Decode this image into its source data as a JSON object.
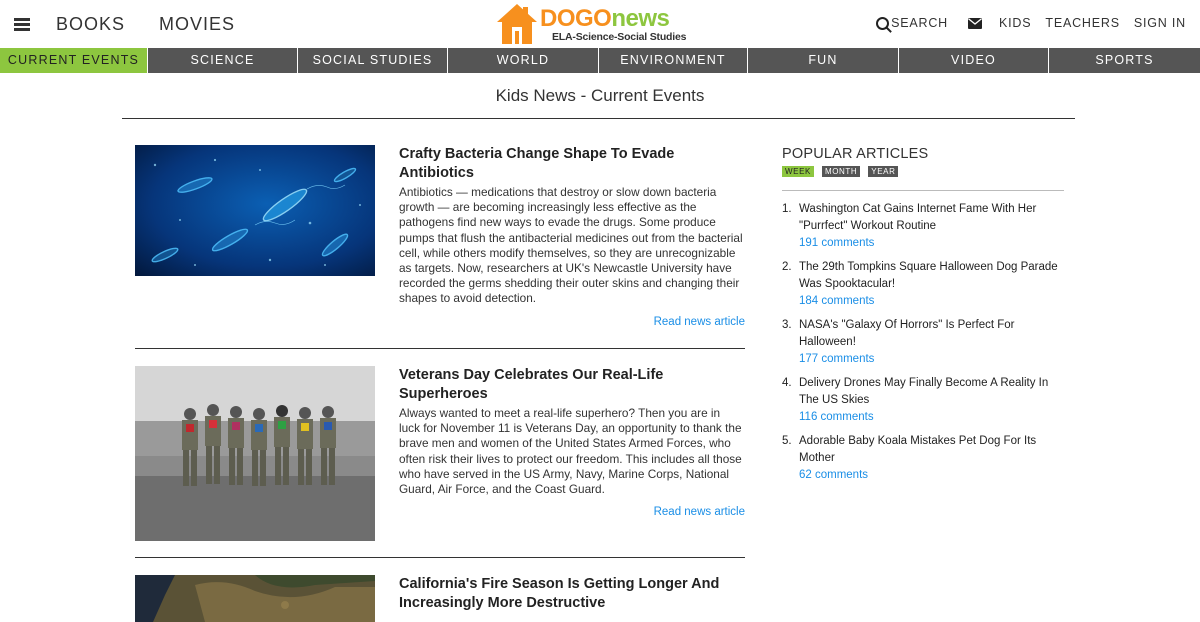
{
  "header": {
    "nav_left": [
      "BOOKS",
      "MOVIES"
    ],
    "logo": {
      "brand_a": "DOGO",
      "brand_b": "news",
      "tagline": "ELA-Science-Social Studies"
    },
    "search_label": "SEARCH",
    "nav_right": [
      "KIDS",
      "TEACHERS",
      "SIGN IN"
    ]
  },
  "categories": [
    "CURRENT EVENTS",
    "SCIENCE",
    "SOCIAL STUDIES",
    "WORLD",
    "ENVIRONMENT",
    "FUN",
    "VIDEO",
    "SPORTS"
  ],
  "page_title": "Kids News - Current Events",
  "articles": [
    {
      "title": "Crafty Bacteria Change Shape To Evade Antibiotics",
      "body": "Antibiotics — medications that destroy or slow down bacteria growth — are becoming increasingly less effective as the pathogens find new ways to evade the drugs. Some produce pumps that flush the antibacterial medicines out from the bacterial cell, while others modify themselves, so they are unrecognizable as targets. Now, researchers at UK's Newcastle University have recorded the germs shedding their outer skins and changing their shapes to avoid detection.",
      "read_more": "Read news article"
    },
    {
      "title": "Veterans Day Celebrates Our Real-Life Superheroes",
      "body": "Always wanted to meet a real-life superhero? Then you are in luck for November 11 is Veterans Day, an opportunity to thank the brave men and women of the United States Armed Forces, who often risk their lives to protect our freedom. This includes all those who have served in the US Army, Navy, Marine Corps, National Guard, Air Force, and the Coast Guard.",
      "read_more": "Read news article"
    },
    {
      "title": "California's Fire Season Is Getting Longer And Increasingly More Destructive"
    }
  ],
  "popular": {
    "title": "POPULAR ARTICLES",
    "tabs": [
      "WEEK",
      "MONTH",
      "YEAR"
    ],
    "items": [
      {
        "num": "1.",
        "title": "Washington Cat Gains Internet Fame With Her \"Purrfect\" Workout Routine",
        "comments": "191 comments"
      },
      {
        "num": "2.",
        "title": "The 29th Tompkins Square Halloween Dog Parade Was Spooktacular!",
        "comments": "184 comments"
      },
      {
        "num": "3.",
        "title": "NASA's \"Galaxy Of Horrors\" Is Perfect For Halloween!",
        "comments": "177 comments"
      },
      {
        "num": "4.",
        "title": "Delivery Drones May Finally Become A Reality In The US Skies",
        "comments": "116 comments"
      },
      {
        "num": "5.",
        "title": "Adorable Baby Koala Mistakes Pet Dog For Its Mother",
        "comments": "62 comments"
      }
    ]
  },
  "colors": {
    "brand_orange": "#f7901e",
    "brand_green": "#8dc63f",
    "nav_gray": "#555555",
    "link_blue": "#1a8ee6"
  }
}
